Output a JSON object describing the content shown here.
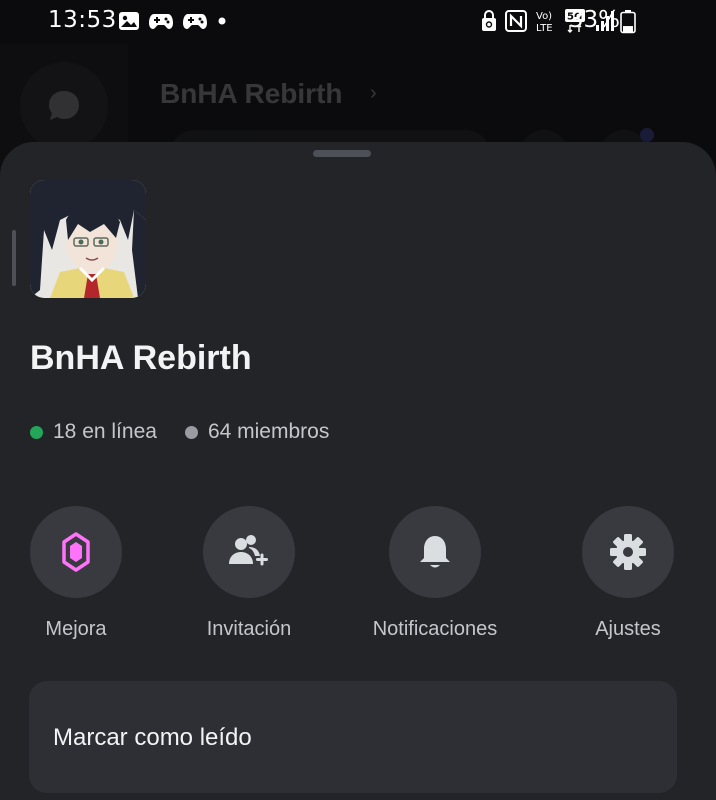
{
  "status_bar": {
    "time": "13:53",
    "left_icons": [
      "image-icon",
      "game-controller-icon",
      "game-controller-icon",
      "notification-dot-icon"
    ],
    "right_icons": [
      "lock-recycle-icon",
      "nfc-icon",
      "volte-icon",
      "5g-icon",
      "signal-icon"
    ],
    "volte_text": "VoLTE",
    "network": "5G",
    "battery_percent": "33%",
    "battery_level": 0.33
  },
  "background_app": {
    "server_title": "BnHA Rebirth"
  },
  "sheet": {
    "server_name": "BnHA Rebirth",
    "online": "18 en línea",
    "members": "64 miembros",
    "actions": [
      {
        "label": "Mejora",
        "icon": "boost-gem-icon"
      },
      {
        "label": "Invitación",
        "icon": "add-friend-icon"
      },
      {
        "label": "Notificaciones",
        "icon": "bell-icon"
      },
      {
        "label": "Ajustes",
        "icon": "gear-icon"
      }
    ],
    "mark_read": "Marcar como leído"
  },
  "colors": {
    "online_dot": "#23a55a",
    "boost_pink": "#ff73fa",
    "sheet_bg": "#232428"
  }
}
